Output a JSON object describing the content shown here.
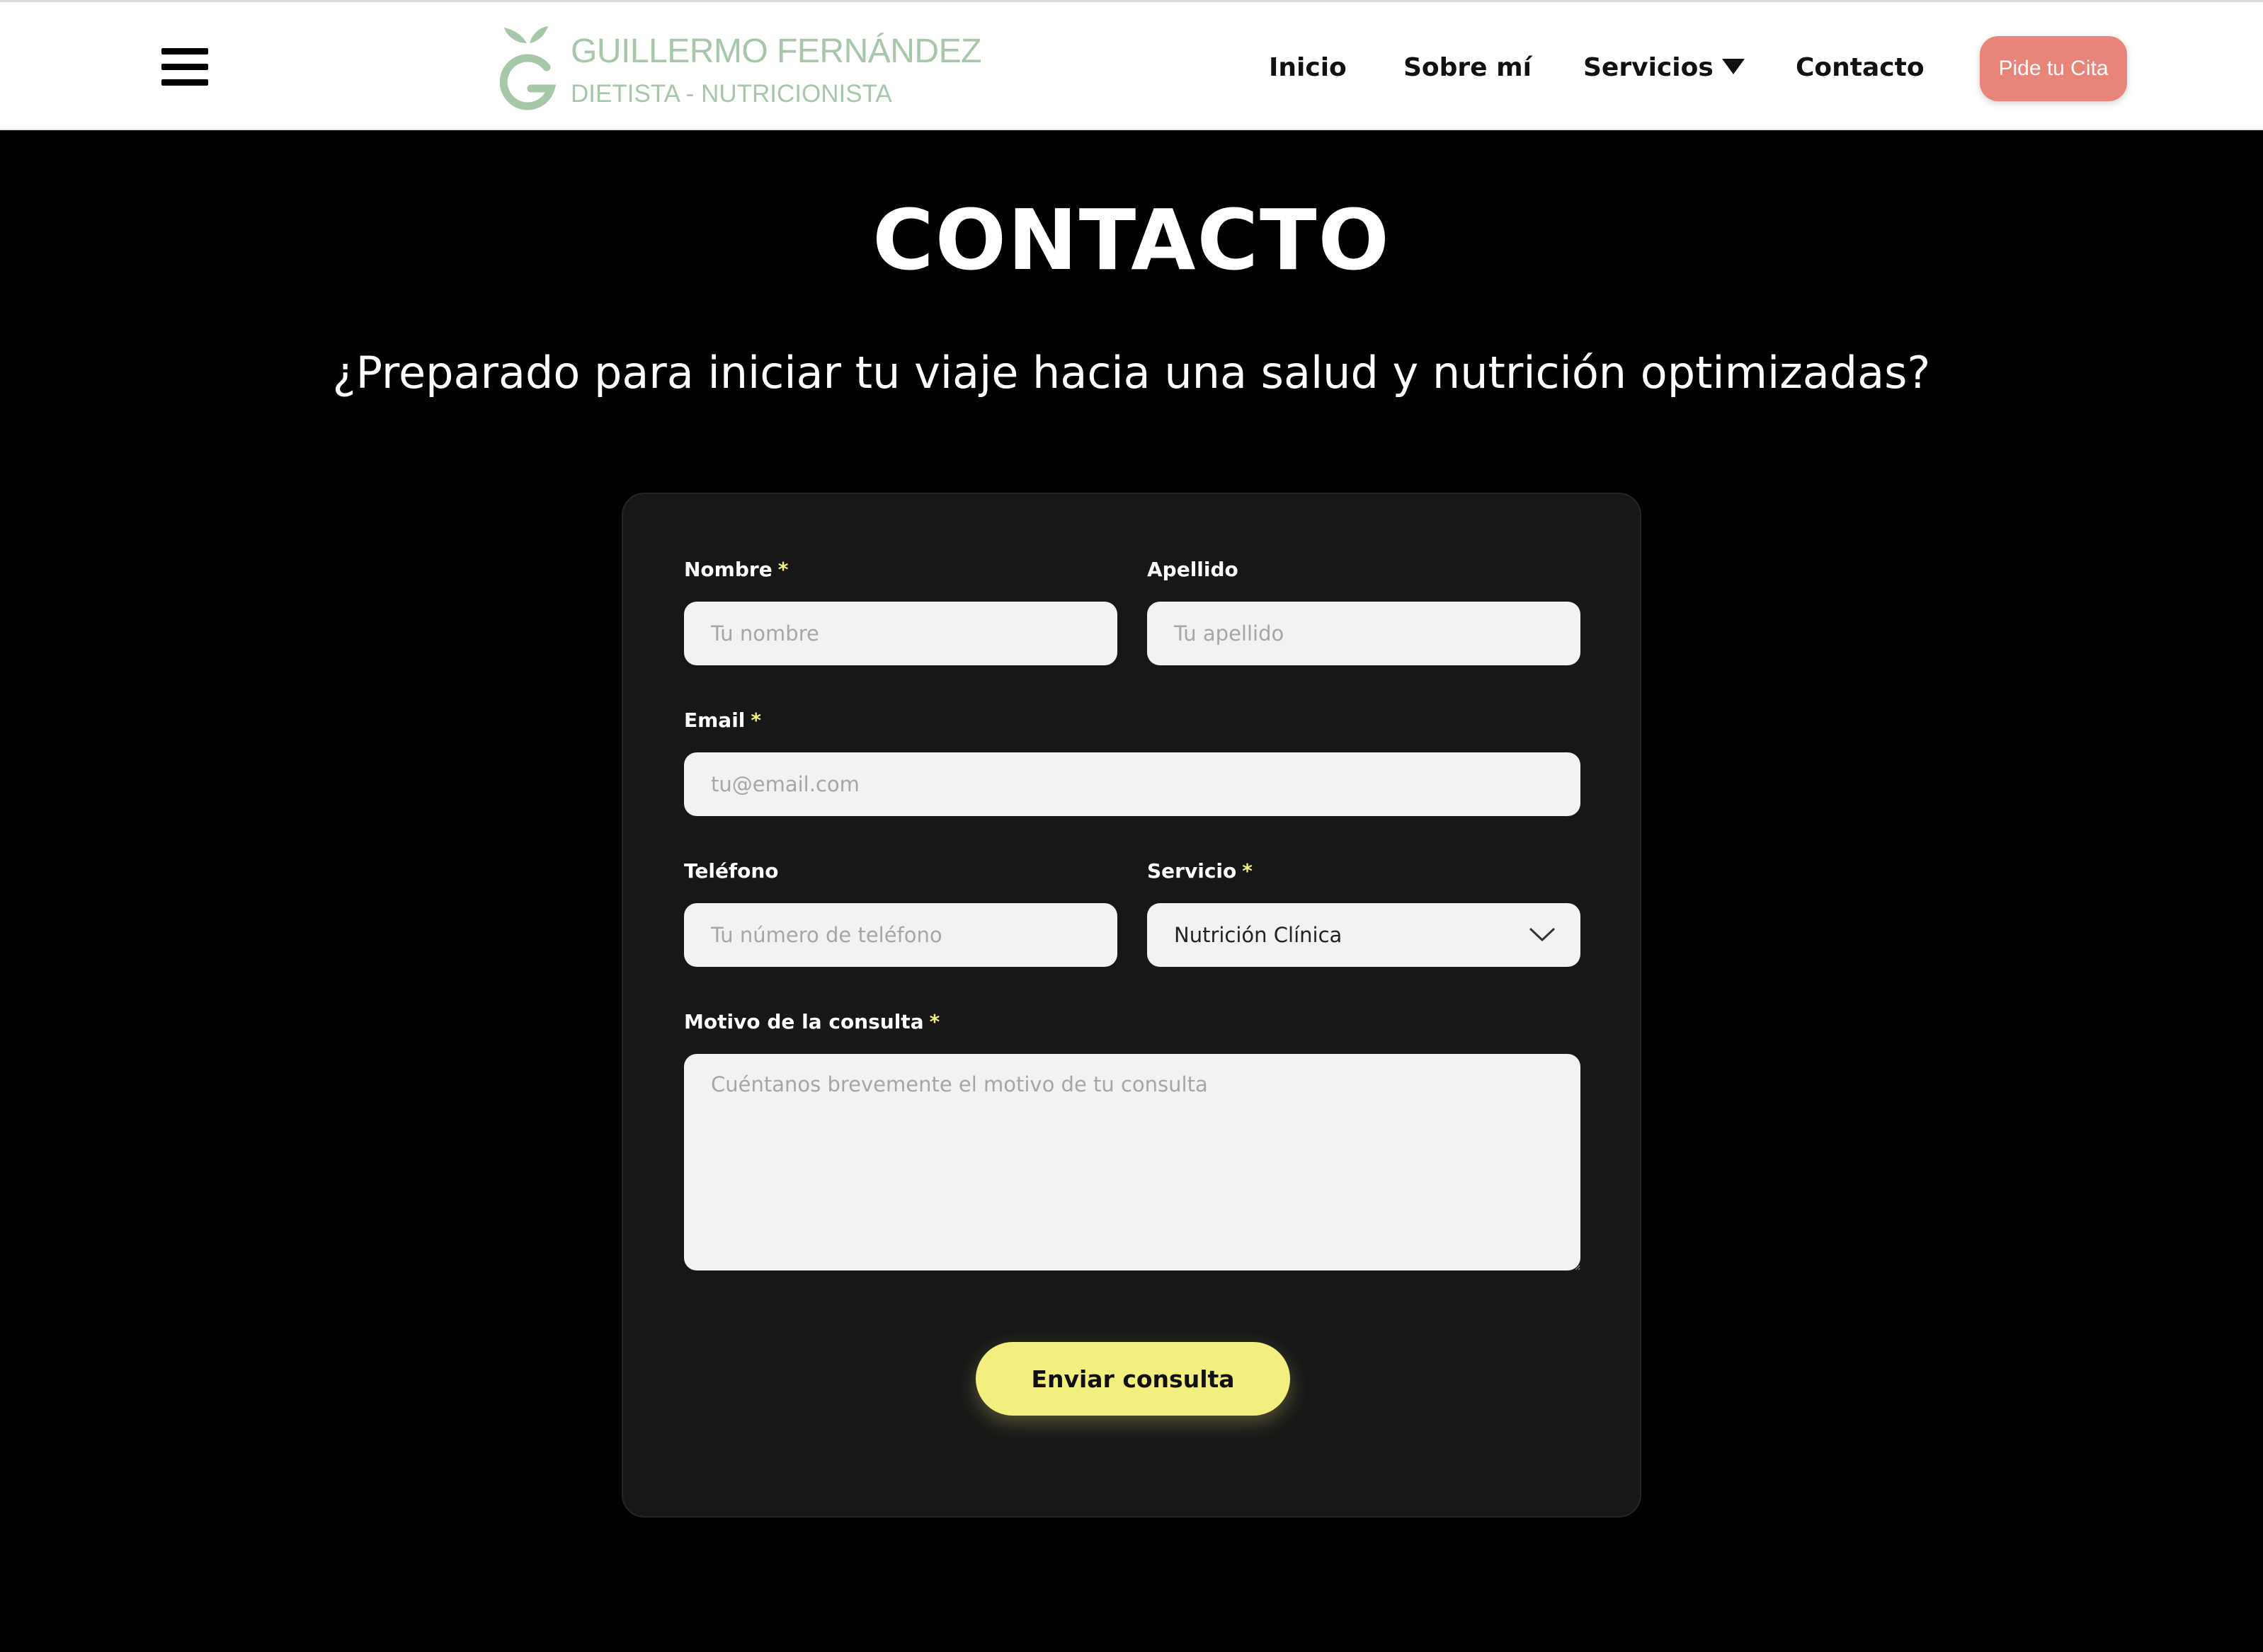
{
  "header": {
    "menu_icon": "hamburger-menu-icon",
    "logo": {
      "name": "GUILLERMO FERNÁNDEZ",
      "subtitle": "DIETISTA - NUTRICIONISTA",
      "icon": "apple-g-logo-icon",
      "color": "#a6c7a9"
    },
    "nav": {
      "inicio": "Inicio",
      "sobre_mi": "Sobre mí",
      "servicios": "Servicios",
      "contacto": "Contacto"
    },
    "cta": "Pide tu Cita",
    "cta_color": "#e8857b"
  },
  "hero": {
    "title": "CONTACTO",
    "subtitle": "¿Preparado para iniciar tu viaje hacia una salud y nutrición optimizadas?"
  },
  "form": {
    "required_marker": "*",
    "accent_color": "#f3ef7f",
    "nombre": {
      "label": "Nombre",
      "placeholder": "Tu nombre",
      "value": ""
    },
    "apellido": {
      "label": "Apellido",
      "placeholder": "Tu apellido",
      "value": ""
    },
    "email": {
      "label": "Email",
      "placeholder": "tu@email.com",
      "value": ""
    },
    "telefono": {
      "label": "Teléfono",
      "placeholder": "Tu número de teléfono",
      "value": ""
    },
    "servicio": {
      "label": "Servicio",
      "selected": "Nutrición Clínica"
    },
    "motivo": {
      "label": "Motivo de la consulta",
      "placeholder": "Cuéntanos brevemente el motivo de tu consulta",
      "value": ""
    },
    "submit": "Enviar consulta"
  }
}
